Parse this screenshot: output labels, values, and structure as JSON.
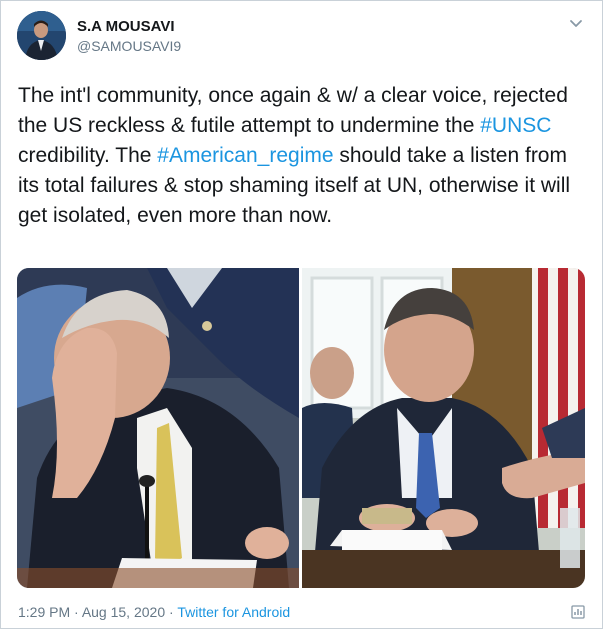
{
  "author": {
    "name": "S.A MOUSAVI",
    "handle": "@SAMOUSAVI9"
  },
  "tweet": {
    "segment_1": "The int'l community, once again & w/ a clear voice, rejected the US reckless & futile attempt to undermine the ",
    "hashtag_1": "#UNSC",
    "segment_2": " credibility. The ",
    "hashtag_2": "#American_regime",
    "segment_3": " should take a listen from its total failures & stop shaming itself at UN, otherwise it will get isolated, even more than now."
  },
  "meta": {
    "time": "1:29 PM",
    "separator": " · ",
    "date": "Aug 15, 2020",
    "source": "Twitter for Android"
  },
  "icons": {
    "menu": "chevron-down-icon",
    "analytics": "analytics-icon"
  },
  "colors": {
    "link": "#1b95e0",
    "secondary_text": "#657786",
    "primary_text": "#14171a"
  }
}
